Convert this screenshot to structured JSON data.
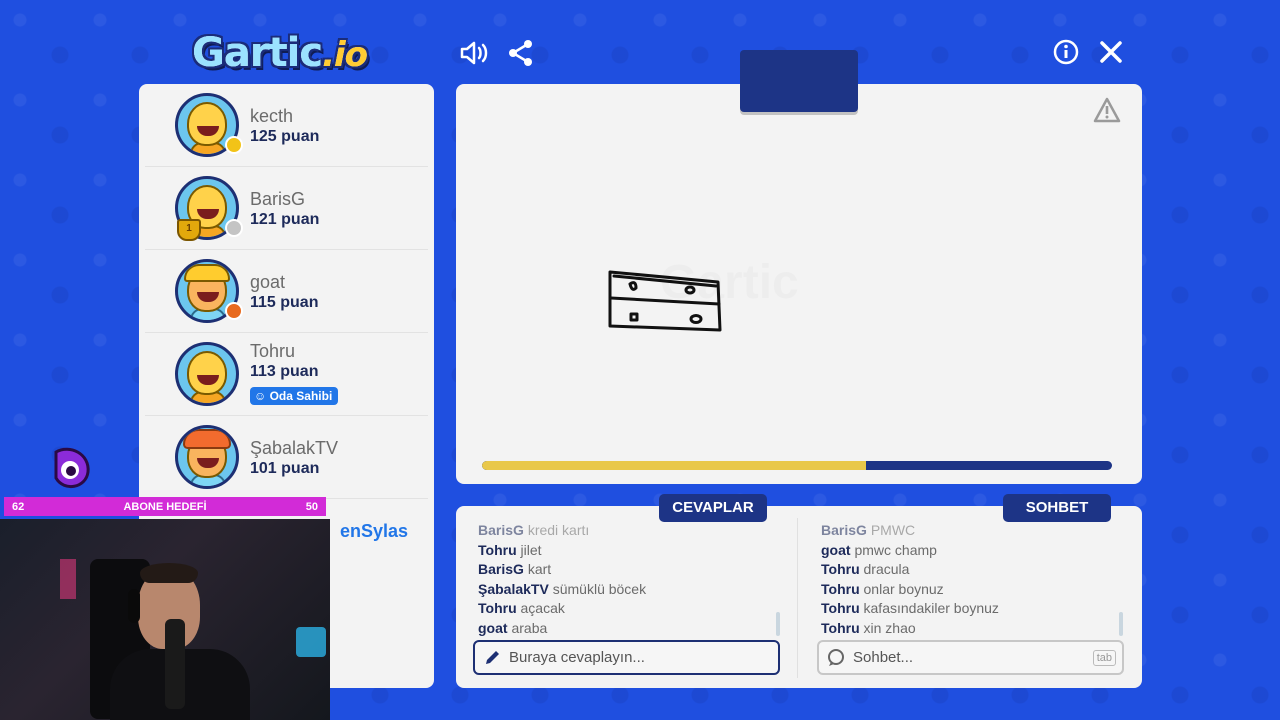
{
  "header": {
    "logo_main": "Gartic",
    "logo_suffix": ".io"
  },
  "players": [
    {
      "name": "kecth",
      "points": "125 puan",
      "status_color": "#f2c318"
    },
    {
      "name": "BarisG",
      "points": "121 puan",
      "status_color": "#c4c4c4",
      "trophy": "1"
    },
    {
      "name": "goat",
      "points": "115 puan",
      "status_color": "#e86a1e"
    },
    {
      "name": "Tohru",
      "points": "113 puan",
      "badge": "Oda Sahibi"
    },
    {
      "name": "ŞabalakTV",
      "points": "101 puan"
    }
  ],
  "partial_player_name": "enSylas",
  "tabs": {
    "answers": "CEVAPLAR",
    "chat": "SOHBET"
  },
  "answers": [
    {
      "user": "BarisG",
      "text": "kredi kartı",
      "faded": true
    },
    {
      "user": "Tohru",
      "text": "jilet"
    },
    {
      "user": "BarisG",
      "text": "kart"
    },
    {
      "user": "ŞabalakTV",
      "text": "sümüklü böcek"
    },
    {
      "user": "Tohru",
      "text": "açacak"
    },
    {
      "user": "goat",
      "text": "araba"
    }
  ],
  "chat": [
    {
      "user": "BarisG",
      "text": "PMWC",
      "faded": true
    },
    {
      "user": "goat",
      "text": "pmwc champ"
    },
    {
      "user": "Tohru",
      "text": "dracula"
    },
    {
      "user": "Tohru",
      "text": "onlar boynuz"
    },
    {
      "user": "Tohru",
      "text": "kafasındakiler boynuz"
    },
    {
      "user": "Tohru",
      "text": "xin zhao"
    }
  ],
  "answer_input": {
    "placeholder": "Buraya cevaplayın..."
  },
  "chat_input": {
    "placeholder": "Sohbet...",
    "key_hint": "tab"
  },
  "timer": {
    "progress": 0.61,
    "fill_color": "#e9c84a",
    "track_color": "#1d3486"
  },
  "stream_overlay": {
    "sub_goal_left": "62",
    "sub_goal_label": "ABONE HEDEFİ",
    "sub_goal_right": "50"
  },
  "colors": {
    "background": "#1f4fe0",
    "panel": "#f3f3f3",
    "navy": "#1d3486",
    "host_badge": "#2176e8"
  }
}
